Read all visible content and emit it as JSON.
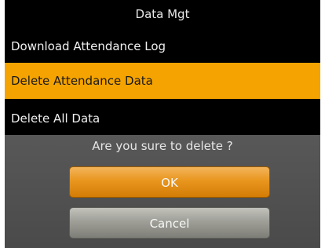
{
  "screen": {
    "title": "Data Mgt"
  },
  "menu": {
    "items": [
      {
        "label": "Download Attendance Log"
      },
      {
        "label": "Delete Attendance Data"
      },
      {
        "label": "Delete All Data"
      }
    ],
    "selected_index": 1
  },
  "dialog": {
    "prompt": "Are you sure to delete ?",
    "ok_label": "OK",
    "cancel_label": "Cancel"
  },
  "colors": {
    "highlight": "#f5a300",
    "background": "#000000",
    "dialog_background": "#525252"
  }
}
